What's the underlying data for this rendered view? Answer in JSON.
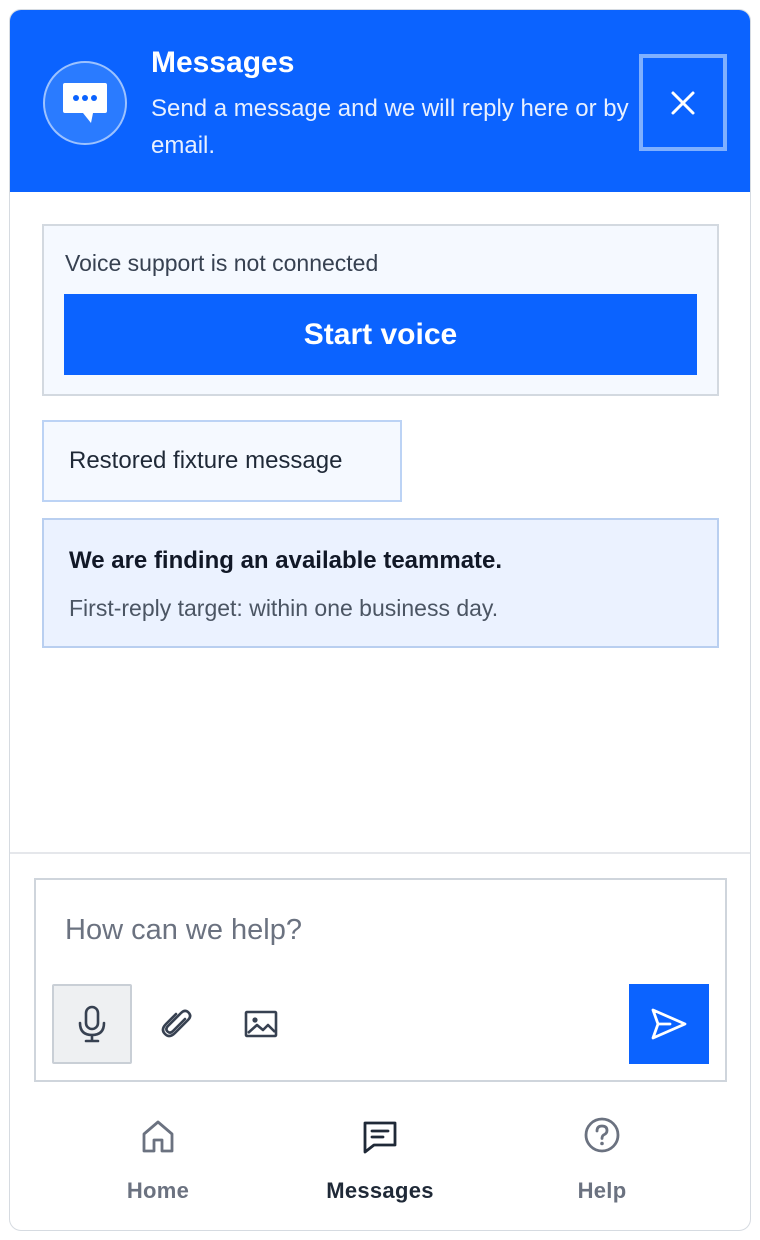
{
  "header": {
    "title": "Messages",
    "subtitle": "Send a message and we will reply here or by email.",
    "avatar_icon": "chat-bubble-icon",
    "close_icon": "close-icon",
    "background_color": "#0b63ff"
  },
  "voice": {
    "status_text": "Voice support is not connected",
    "button_label": "Start voice"
  },
  "messages": [
    {
      "text": "Restored fixture message"
    }
  ],
  "notice": {
    "title": "We are finding an available teammate.",
    "text": "First-reply target: within one business day."
  },
  "composer": {
    "placeholder": "How can we help?",
    "value": "",
    "tools": [
      "microphone-icon",
      "paperclip-icon",
      "image-icon"
    ],
    "send_icon": "send-icon"
  },
  "nav": {
    "items": [
      {
        "label": "Home",
        "icon": "home-icon",
        "active": false
      },
      {
        "label": "Messages",
        "icon": "messages-icon",
        "active": true
      },
      {
        "label": "Help",
        "icon": "help-icon",
        "active": false
      }
    ]
  },
  "colors": {
    "accent": "#0b63ff",
    "notice_bg": "#ebf2ff",
    "text_muted": "#6b7280"
  }
}
